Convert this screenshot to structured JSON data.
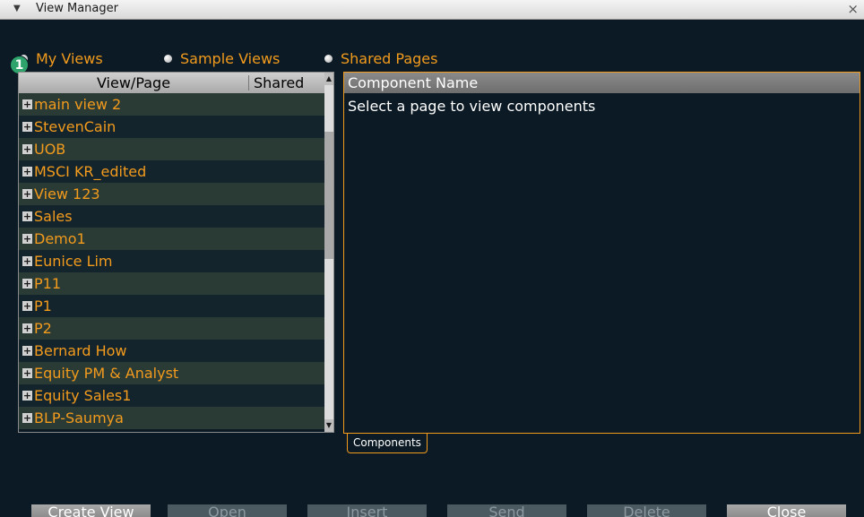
{
  "window": {
    "title": "View Manager",
    "close_glyph": "×",
    "menu_glyph": "▼"
  },
  "view_modes": [
    {
      "label": "My Views",
      "selected": true
    },
    {
      "label": "Sample Views",
      "selected": false
    },
    {
      "label": "Shared Pages",
      "selected": false
    }
  ],
  "badge": {
    "text": "1",
    "color": "#2ea36b"
  },
  "tree": {
    "columns": {
      "view_page": "View/Page",
      "shared": "Shared"
    },
    "items": [
      "main view 2",
      "StevenCain",
      "UOB",
      "MSCI KR_edited",
      "View 123",
      "Sales",
      "Demo1",
      "Eunice Lim",
      "P11",
      "P1",
      "P2",
      "Bernard How",
      "Equity PM & Analyst",
      "Equity Sales1",
      "BLP-Saumya"
    ]
  },
  "components": {
    "header": "Component Name",
    "empty_message": "Select a page to view components",
    "tab_label": "Components"
  },
  "buttons": {
    "create_view": "Create View",
    "open": "Open",
    "insert": "Insert",
    "send": "Send",
    "delete": "Delete",
    "close": "Close"
  },
  "colors": {
    "accent": "#f29b1d",
    "background": "#0b1a24"
  }
}
